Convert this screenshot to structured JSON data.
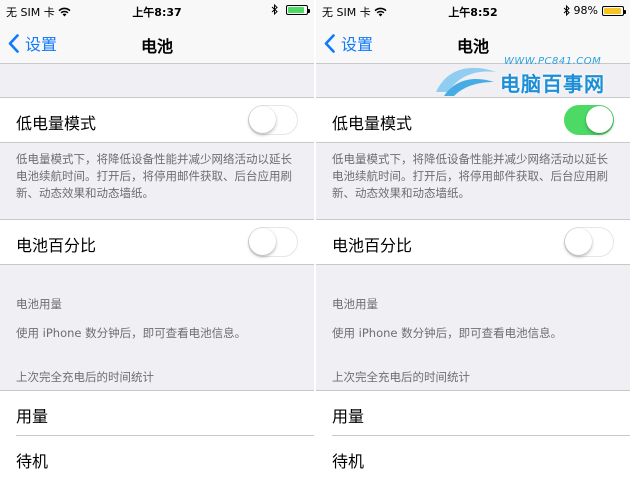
{
  "left": {
    "status": {
      "carrier": "无 SIM 卡",
      "time": "上午8:37",
      "battery_percent": "",
      "battery_level": 0.9,
      "battery_color": "#4cd964"
    },
    "nav": {
      "back_label": "设置",
      "title": "电池"
    },
    "low_power": {
      "label": "低电量模式",
      "on": false
    },
    "low_power_note": "低电量模式下，将降低设备性能并减少网络活动以延长电池续航时间。打开后，将停用邮件获取、后台应用刷新、动态效果和动态墙纸。",
    "battery_pct": {
      "label": "电池百分比",
      "on": false
    },
    "usage_header": "电池用量",
    "usage_note": "使用 iPhone 数分钟后，即可查看电池信息。",
    "since_header": "上次完全充电后的时间统计",
    "rows": [
      "用量",
      "待机"
    ]
  },
  "right": {
    "status": {
      "carrier": "无 SIM 卡",
      "time": "上午8:52",
      "battery_percent": "98%",
      "battery_level": 0.95,
      "battery_color": "#f7c325"
    },
    "nav": {
      "back_label": "设置",
      "title": "电池"
    },
    "low_power": {
      "label": "低电量模式",
      "on": true
    },
    "low_power_note": "低电量模式下，将降低设备性能并减少网络活动以延长电池续航时间。打开后，将停用邮件获取、后台应用刷新、动态效果和动态墙纸。",
    "battery_pct": {
      "label": "电池百分比",
      "on": false
    },
    "usage_header": "电池用量",
    "usage_note": "使用 iPhone 数分钟后，即可查看电池信息。",
    "since_header": "上次完全充电后的时间统计",
    "rows": [
      "用量",
      "待机"
    ]
  },
  "watermark": {
    "url": "WWW.PC841.COM",
    "brand": "电脑百事网"
  },
  "colors": {
    "ios_blue": "#0e7afe",
    "switch_on": "#4cd964",
    "group_bg": "#efeff4",
    "footnote": "#6d6d72"
  }
}
